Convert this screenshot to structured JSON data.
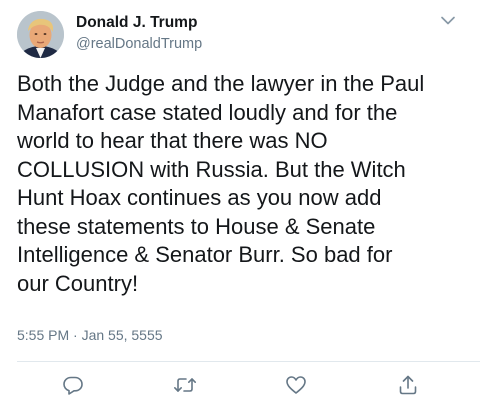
{
  "tweet": {
    "display_name": "Donald J. Trump",
    "handle": "@realDonaldTrump",
    "text_lines": [
      "Both the Judge and the lawyer in the Paul",
      "Manafort case stated loudly and for the",
      "world to hear that there was NO",
      "COLLUSION with Russia. But the Witch",
      "Hunt Hoax continues as you now add",
      "these statements to House & Senate",
      "Intelligence & Senator Burr. So bad for",
      "our Country!"
    ],
    "timestamp": "5:55 PM · Jan 55, 5555"
  },
  "icons": {
    "more": "chevron-down-icon",
    "reply": "reply-icon",
    "retweet": "retweet-icon",
    "like": "heart-icon",
    "share": "share-icon"
  },
  "colors": {
    "text": "#14171a",
    "secondary": "#657786",
    "divider": "#e1e8ed"
  }
}
